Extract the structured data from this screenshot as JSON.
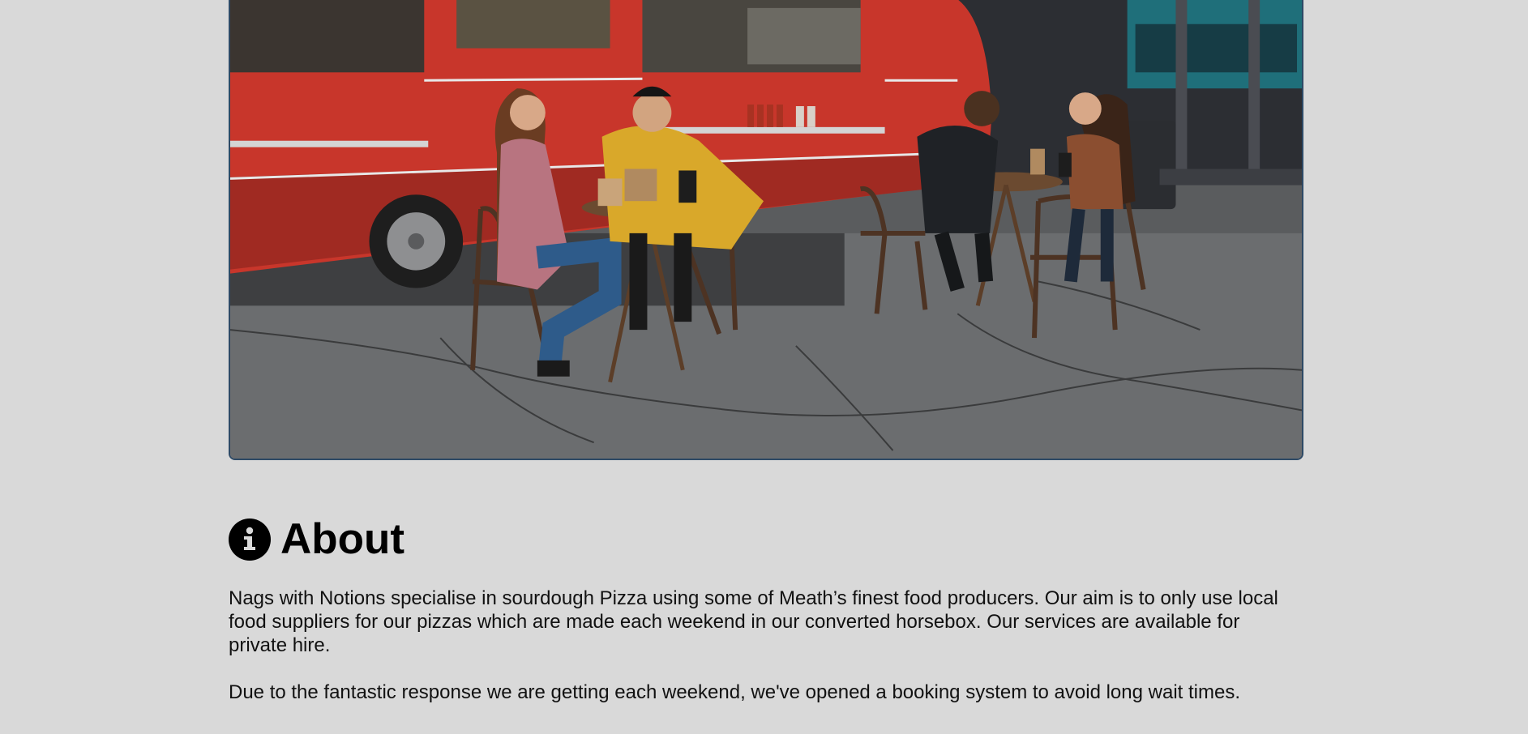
{
  "hero": {
    "image_description": "Food truck hero photo"
  },
  "about": {
    "icon": "info-circle-icon",
    "title": "About",
    "paragraphs": [
      "Nags with Notions specialise in sourdough Pizza using some of Meath’s finest food producers. Our aim is to only use local food suppliers for our pizzas which are made each weekend in our converted horsebox. Our services are available for private hire.",
      "Due to the fantastic response we are getting each weekend, we've opened a booking system to avoid long wait times."
    ]
  },
  "colors": {
    "page_background": "#d9d9d9",
    "image_border": "#2e4a66",
    "truck_red": "#c8362b",
    "text": "#111111"
  }
}
